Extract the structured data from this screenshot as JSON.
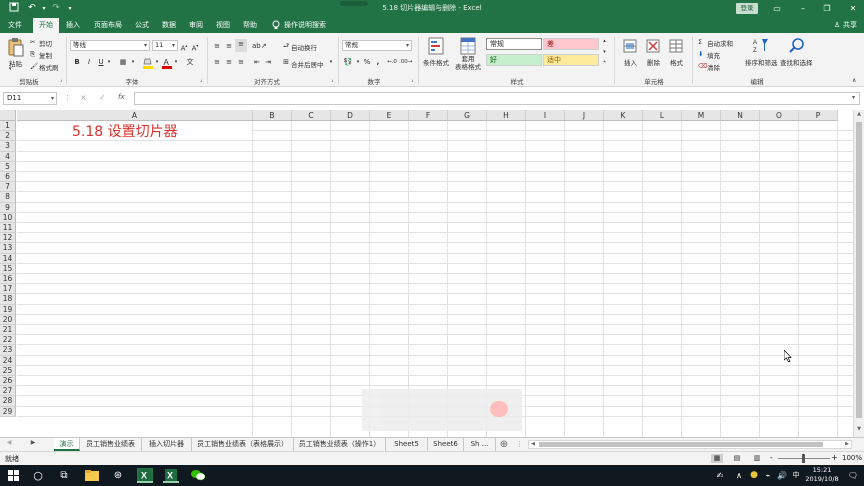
{
  "window": {
    "title": "5.18 切片器编辑与删除 - Excel",
    "login_label": "登录",
    "share_label": "共享",
    "undo_icon": "undo-icon",
    "redo_icon": "redo-icon",
    "save_icon": "save-icon"
  },
  "tabs": [
    "文件",
    "开始",
    "插入",
    "页面布局",
    "公式",
    "数据",
    "审阅",
    "视图",
    "帮助"
  ],
  "active_tab": "开始",
  "tell_me": "操作说明搜索",
  "ribbon": {
    "clipboard": {
      "label": "剪贴板",
      "paste": "粘贴",
      "cut": "剪切",
      "copy": "复制",
      "format_painter": "格式刷"
    },
    "font": {
      "label": "字体",
      "font_name": "等线",
      "font_size": "11",
      "bold": "B",
      "italic": "I",
      "underline": "U"
    },
    "alignment": {
      "label": "对齐方式",
      "wrap_text": "自动换行",
      "merge_center": "合并后居中"
    },
    "number": {
      "label": "数字",
      "format": "常规",
      "percent": "%",
      "comma": ","
    },
    "styles": {
      "label": "样式",
      "conditional": "条件格式",
      "table_format": "套用\n表格格式",
      "cell_styles": [
        {
          "name": "常规",
          "bg": "#ffffff",
          "color": "#222222"
        },
        {
          "name": "差",
          "bg": "#ffc7ce",
          "color": "#9c0006"
        },
        {
          "name": "好",
          "bg": "#c6efce",
          "color": "#006100"
        },
        {
          "name": "适中",
          "bg": "#ffeb9c",
          "color": "#9c5700"
        }
      ]
    },
    "cells": {
      "label": "单元格",
      "insert": "插入",
      "delete": "删除",
      "format": "格式"
    },
    "editing": {
      "label": "编辑",
      "autosum": "自动求和",
      "fill": "填充",
      "clear": "清除",
      "sort_filter": "排序和筛选",
      "find_select": "查找和选择"
    }
  },
  "formula_bar": {
    "name_box": "D11",
    "cancel": "×",
    "enter": "✓",
    "fx": "fx",
    "content": ""
  },
  "grid": {
    "columns": [
      "A",
      "B",
      "C",
      "D",
      "E",
      "F",
      "G",
      "H",
      "I",
      "J",
      "K",
      "L",
      "M",
      "N",
      "O",
      "P"
    ],
    "rows": [
      "1",
      "2",
      "3",
      "4",
      "5",
      "6",
      "7",
      "8",
      "9",
      "10",
      "11",
      "12",
      "13",
      "14",
      "15",
      "16",
      "17",
      "18",
      "19",
      "20",
      "21",
      "22",
      "23",
      "24",
      "25",
      "26",
      "27",
      "28",
      "29"
    ],
    "a1_text": "5.18 设置切片器",
    "a1_color": "#d9322d"
  },
  "sheets": [
    "演示",
    "员工销售业绩表",
    "插入切片器",
    "员工销售业绩表（表格展示）",
    "员工销售业绩表（操作1）",
    "Sheet5",
    "Sheet6",
    "Sh ..."
  ],
  "active_sheet": "演示",
  "status": {
    "ready": "就绪",
    "zoom": "100%",
    "minus": "-",
    "plus": "+"
  },
  "taskbar": {
    "time": "15:21",
    "date": "2019/10/8",
    "ime": "中"
  },
  "colors": {
    "accent": "#217346",
    "ribbon_bg": "#f3f3f3",
    "taskbar": "#101820"
  }
}
